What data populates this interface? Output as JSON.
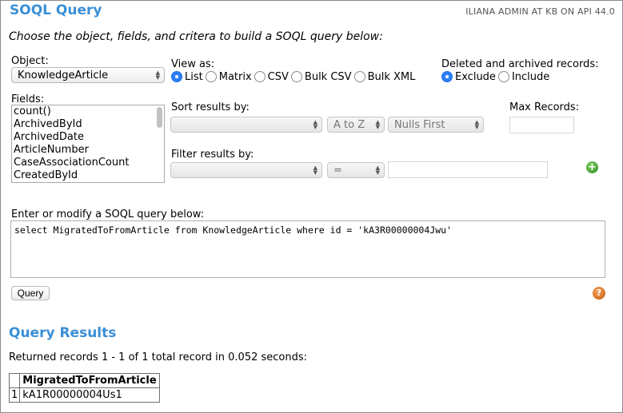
{
  "header": {
    "title": "SOQL Query",
    "user_info": "ILIANA ADMIN AT KB ON API 44.0"
  },
  "instruction": "Choose the object, fields, and critera to build a SOQL query below:",
  "object": {
    "label": "Object:",
    "selected": "KnowledgeArticle"
  },
  "view_as": {
    "label": "View as:",
    "options": [
      "List",
      "Matrix",
      "CSV",
      "Bulk CSV",
      "Bulk XML"
    ],
    "selected": "List"
  },
  "deleted": {
    "label": "Deleted and archived records:",
    "options": [
      "Exclude",
      "Include"
    ],
    "selected": "Exclude"
  },
  "fields": {
    "label": "Fields:",
    "items": [
      "count()",
      "ArchivedById",
      "ArchivedDate",
      "ArticleNumber",
      "CaseAssociationCount",
      "CreatedById"
    ]
  },
  "sort": {
    "label": "Sort results by:",
    "field": "",
    "direction": "A to Z",
    "nulls": "Nulls First"
  },
  "max_records": {
    "label": "Max Records:",
    "value": ""
  },
  "filter": {
    "label": "Filter results by:",
    "field": "",
    "operator": "=",
    "value": ""
  },
  "query_editor": {
    "label": "Enter or modify a SOQL query below:",
    "value": "select MigratedToFromArticle from KnowledgeArticle where id = 'kA3R00000004Jwu'"
  },
  "query_button": "Query",
  "results": {
    "title": "Query Results",
    "summary": "Returned records 1 - 1 of 1 total record in 0.052 seconds:",
    "columns": [
      "MigratedToFromArticle"
    ],
    "rows": [
      {
        "index": "1",
        "cells": [
          "kA1R00000004Us1"
        ]
      }
    ]
  },
  "icons": {
    "add_filter": "plus-circle-icon",
    "help": "question-circle-icon"
  },
  "colors": {
    "heading": "#3a8fd6",
    "radio_selected": "#2d7ff9",
    "add_icon": "#3ea52a",
    "help_icon": "#e07a2a"
  }
}
